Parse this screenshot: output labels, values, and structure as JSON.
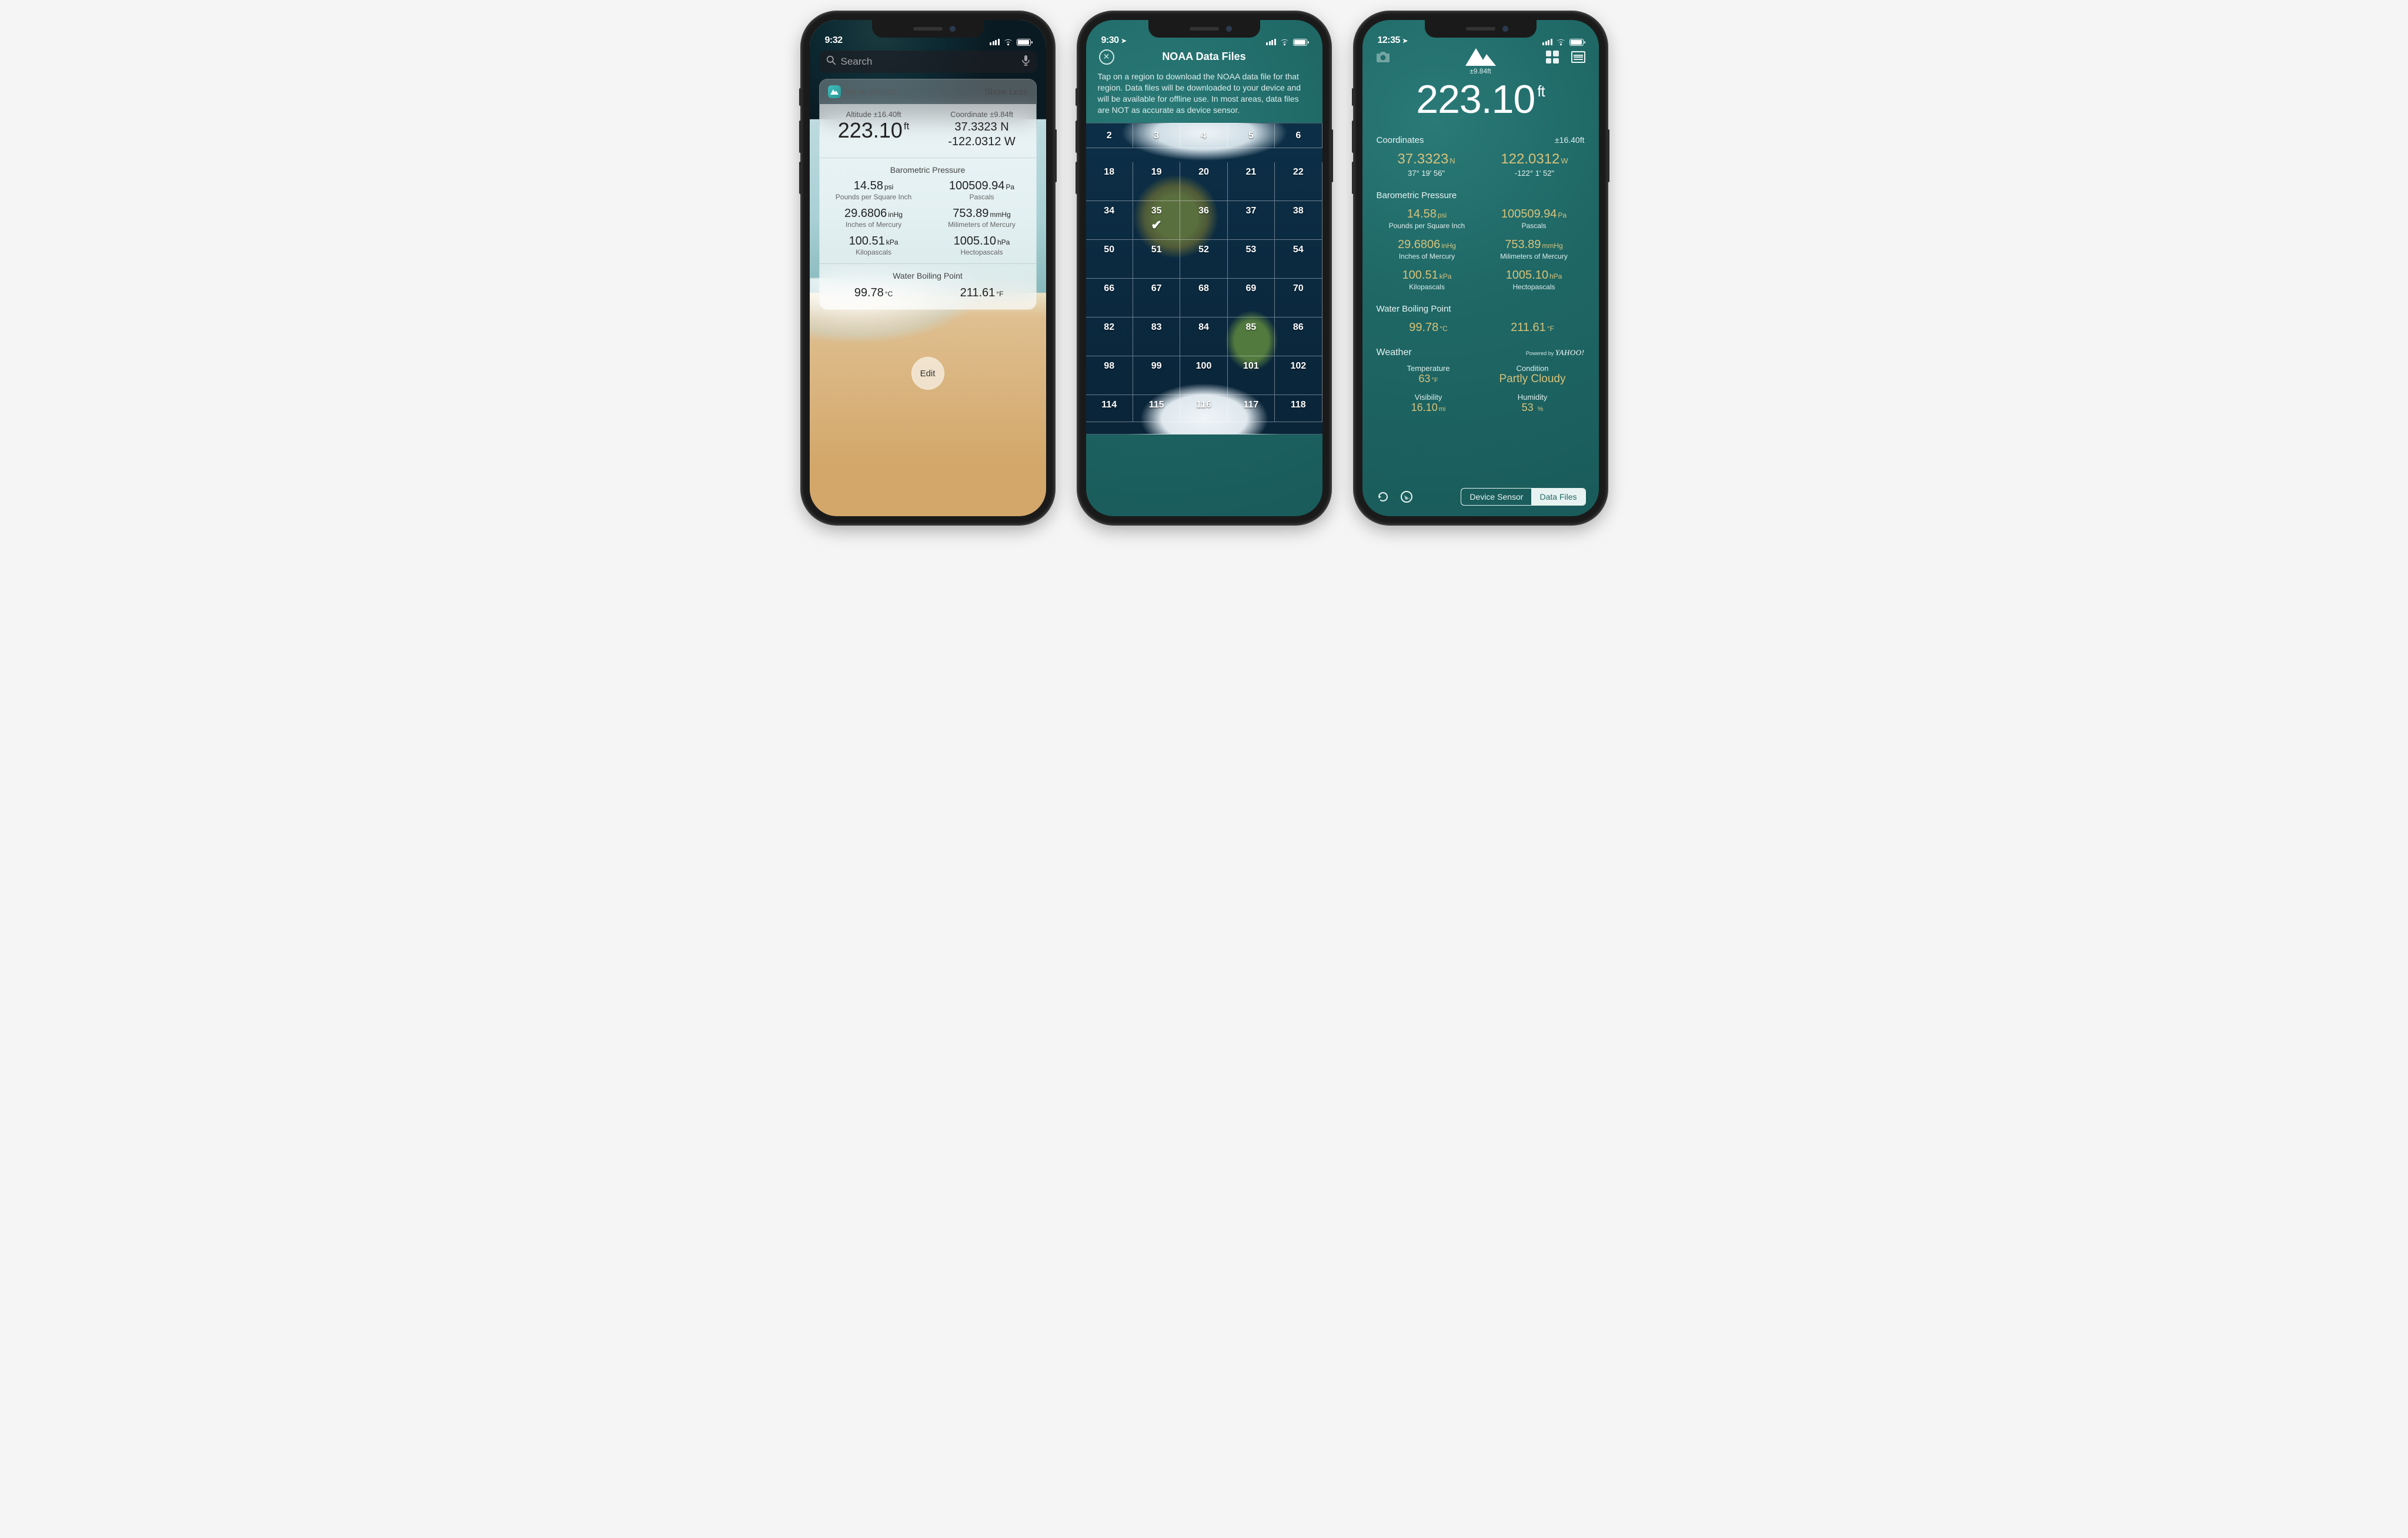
{
  "phone1": {
    "time": "9:32",
    "search_placeholder": "Search",
    "widget": {
      "app_name": "MY ALTITUDE",
      "show_less": "Show Less",
      "alt_label": "Altitude ±16.40ft",
      "alt_value": "223.10",
      "alt_unit": "ft",
      "coord_label": "Coordinate ±9.84ft",
      "coord_lat": "37.3323 N",
      "coord_lon": "-122.0312 W",
      "pressure_title": "Barometric Pressure",
      "pressure": [
        {
          "value": "14.58",
          "unit": "psi",
          "label": "Pounds per Square Inch"
        },
        {
          "value": "100509.94",
          "unit": "Pa",
          "label": "Pascals"
        },
        {
          "value": "29.6806",
          "unit": "inHg",
          "label": "Inches of Mercury"
        },
        {
          "value": "753.89",
          "unit": "mmHg",
          "label": "Milimeters of Mercury"
        },
        {
          "value": "100.51",
          "unit": "kPa",
          "label": "Kilopascals"
        },
        {
          "value": "1005.10",
          "unit": "hPa",
          "label": "Hectopascals"
        }
      ],
      "boiling_title": "Water Boiling Point",
      "boiling_c": "99.78",
      "boiling_c_unit": "°C",
      "boiling_f": "211.61",
      "boiling_f_unit": "°F"
    },
    "edit_label": "Edit"
  },
  "phone2": {
    "time": "9:30",
    "title": "NOAA Data Files",
    "instructions": "Tap on a region to download the NOAA data file for that region. Data files will be downloaded to your device and will be available for offline use. In most areas, data files are NOT as accurate as device sensor.",
    "rows": [
      [
        "2",
        "3",
        "4",
        "5",
        "6"
      ],
      [
        "18",
        "19",
        "20",
        "21",
        "22"
      ],
      [
        "34",
        "35",
        "36",
        "37",
        "38"
      ],
      [
        "50",
        "51",
        "52",
        "53",
        "54"
      ],
      [
        "66",
        "67",
        "68",
        "69",
        "70"
      ],
      [
        "82",
        "83",
        "84",
        "85",
        "86"
      ],
      [
        "98",
        "99",
        "100",
        "101",
        "102"
      ],
      [
        "114",
        "115",
        "116",
        "117",
        "118"
      ]
    ],
    "selected_region": "35"
  },
  "phone3": {
    "time": "12:35",
    "mountain_tolerance": "±9.84ft",
    "altitude_value": "223.10",
    "altitude_unit": "ft",
    "coordinates_label": "Coordinates",
    "coordinates_tol": "±16.40ft",
    "lat_value": "37.3323",
    "lat_dir": "N",
    "lat_dms": "37° 19' 56\"",
    "lon_value": "122.0312",
    "lon_dir": "W",
    "lon_dms": "-122° 1' 52\"",
    "pressure_title": "Barometric Pressure",
    "pressure": [
      {
        "value": "14.58",
        "unit": "psi",
        "label": "Pounds per Square Inch"
      },
      {
        "value": "100509.94",
        "unit": "Pa",
        "label": "Pascals"
      },
      {
        "value": "29.6806",
        "unit": "inHg",
        "label": "Inches of Mercury"
      },
      {
        "value": "753.89",
        "unit": "mmHg",
        "label": "Milimeters of Mercury"
      },
      {
        "value": "100.51",
        "unit": "kPa",
        "label": "Kilopascals"
      },
      {
        "value": "1005.10",
        "unit": "hPa",
        "label": "Hectopascals"
      }
    ],
    "boiling_title": "Water Boiling Point",
    "boiling_c": "99.78",
    "boiling_c_unit": "°C",
    "boiling_f": "211.61",
    "boiling_f_unit": "°F",
    "weather_label": "Weather",
    "weather_powered_prefix": "Powered by",
    "weather_powered_brand": "YAHOO!",
    "weather": {
      "temperature_label": "Temperature",
      "temperature_value": "63",
      "temperature_unit": "°F",
      "condition_label": "Condition",
      "condition_value": "Partly Cloudy",
      "visibility_label": "Visibility",
      "visibility_value": "16.10",
      "visibility_unit": "mi",
      "humidity_label": "Humidity",
      "humidity_value": "53",
      "humidity_unit": "%"
    },
    "segment_device": "Device Sensor",
    "segment_files": "Data Files"
  }
}
